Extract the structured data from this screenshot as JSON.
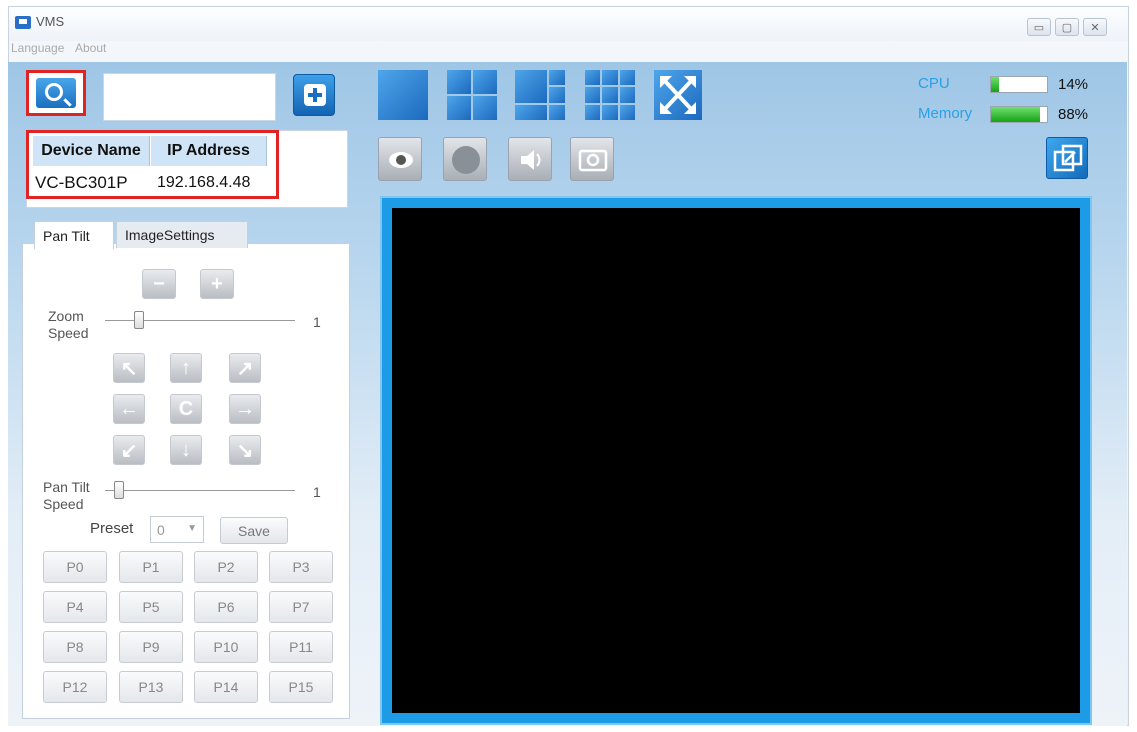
{
  "window": {
    "title": "VMS",
    "controls": {
      "minimize": "▭",
      "maximize": "▢",
      "close": "✕"
    }
  },
  "menu": {
    "items": [
      "Language",
      "About"
    ]
  },
  "toolbar": {
    "search_icon": "search-icon",
    "add_icon": "plus-icon",
    "search_value": ""
  },
  "device_table": {
    "columns": [
      "Device Name",
      "IP Address"
    ],
    "rows": [
      {
        "device_name": "VC-BC301P",
        "ip_address": "192.168.4.48"
      }
    ]
  },
  "tabs": [
    "Pan Tilt",
    "ImageSettings"
  ],
  "pan_tilt": {
    "zoom_speed_label": "Zoom Speed",
    "zoom_speed_value": "1",
    "pan_tilt_speed_label": "Pan Tilt Speed",
    "pan_tilt_speed_value": "1",
    "direction_icons": [
      "↖",
      "↑",
      "↗",
      "←",
      "C",
      "→",
      "↙",
      "↓",
      "↘"
    ],
    "zoom_out_icon": "−",
    "zoom_in_icon": "+",
    "preset_label": "Preset",
    "preset_value": "0",
    "save_label": "Save",
    "presets": [
      "P0",
      "P1",
      "P2",
      "P3",
      "P4",
      "P5",
      "P6",
      "P7",
      "P8",
      "P9",
      "P10",
      "P11",
      "P12",
      "P13",
      "P14",
      "P15"
    ]
  },
  "stats": {
    "cpu_label": "CPU",
    "cpu_value": "14%",
    "cpu_fraction": 0.14,
    "memory_label": "Memory",
    "memory_value": "88%",
    "memory_fraction": 0.88
  },
  "colors": {
    "accent": "#1b6fc0",
    "highlight": "#e02424",
    "meter": "#17a317",
    "video_frame": "#1e9be6"
  }
}
